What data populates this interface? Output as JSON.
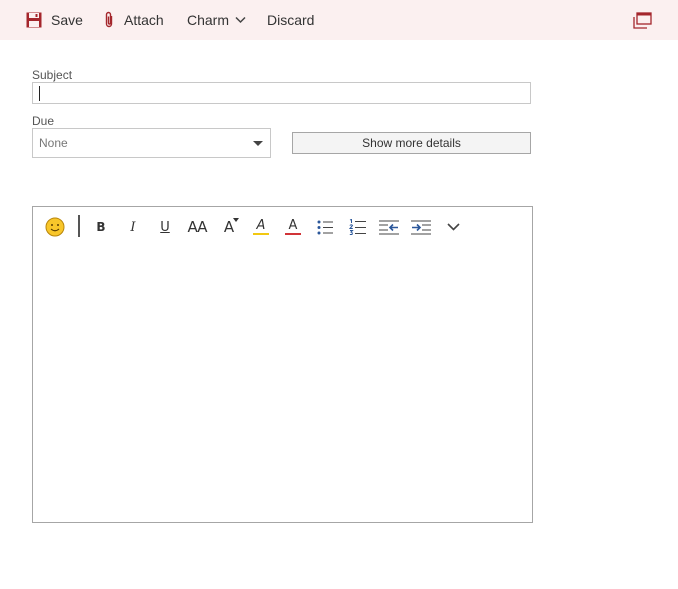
{
  "toolbar": {
    "save_label": "Save",
    "attach_label": "Attach",
    "charm_label": "Charm",
    "discard_label": "Discard"
  },
  "form": {
    "subject_label": "Subject",
    "subject_value": "",
    "due_label": "Due",
    "due_value": "None",
    "more_details_label": "Show more details"
  },
  "format_toolbar": {
    "bold_glyph": "B",
    "italic_glyph": "I",
    "underline_glyph": "U",
    "font_size_glyph": "AA",
    "grow_font_glyph": "A",
    "highlight_glyph": "A",
    "font_color_glyph": "A"
  },
  "colors": {
    "accent": "#a4262c",
    "topbar_bg": "#fbf0f0",
    "highlight": "#f2c811",
    "font_color": "#d13438",
    "indent_blue": "#2b579a",
    "emoji": "#f8c62a"
  },
  "icons": [
    "save-icon",
    "paperclip-icon",
    "chevron-down-icon",
    "popout-icon",
    "emoji-icon",
    "bullets-icon",
    "numbering-icon",
    "decrease-indent-icon",
    "increase-indent-icon",
    "more-options-icon"
  ]
}
